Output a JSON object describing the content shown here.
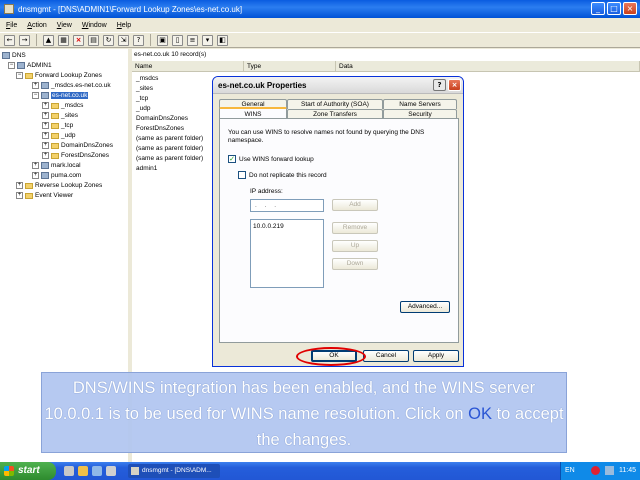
{
  "window": {
    "title": "dnsmgmt - [DNS\\ADMIN1\\Forward Lookup Zones\\es-net.co.uk]",
    "menu": [
      "File",
      "Action",
      "View",
      "Window",
      "Help"
    ]
  },
  "tree": [
    {
      "label": "DNS",
      "indent": 0,
      "type": "dns"
    },
    {
      "label": "ADMIN1",
      "indent": 1,
      "type": "server"
    },
    {
      "label": "Forward Lookup Zones",
      "indent": 2,
      "type": "folder"
    },
    {
      "label": "_msdcs.es-net.co.uk",
      "indent": 3,
      "type": "zone"
    },
    {
      "label": "es-net.co.uk",
      "indent": 3,
      "type": "zone",
      "selected": true
    },
    {
      "label": "_msdcs",
      "indent": 4,
      "type": "folder"
    },
    {
      "label": "_sites",
      "indent": 4,
      "type": "folder"
    },
    {
      "label": "_tcp",
      "indent": 4,
      "type": "folder"
    },
    {
      "label": "_udp",
      "indent": 4,
      "type": "folder"
    },
    {
      "label": "DomainDnsZones",
      "indent": 4,
      "type": "folder"
    },
    {
      "label": "ForestDnsZones",
      "indent": 4,
      "type": "folder"
    },
    {
      "label": "mark.local",
      "indent": 3,
      "type": "zone"
    },
    {
      "label": "puma.com",
      "indent": 3,
      "type": "zone"
    },
    {
      "label": "Reverse Lookup Zones",
      "indent": 2,
      "type": "folder"
    },
    {
      "label": "Event Viewer",
      "indent": 2,
      "type": "folder"
    }
  ],
  "list": {
    "header": "es-net.co.uk    10 record(s)",
    "columns": [
      "Name",
      "Type",
      "Data"
    ],
    "rows": [
      "_msdcs",
      "_sites",
      "_tcp",
      "_udp",
      "DomainDnsZones",
      "ForestDnsZones",
      "(same as parent folder)",
      "(same as parent folder)",
      "(same as parent folder)",
      "admin1"
    ]
  },
  "dialog": {
    "title": "es-net.co.uk Properties",
    "tabs_back": [
      "General",
      "Start of Authority (SOA)",
      "Name Servers"
    ],
    "tabs_front": [
      "WINS",
      "Zone Transfers",
      "Security"
    ],
    "description": "You can use WINS to resolve names not found by querying the DNS namespace.",
    "use_wins_label": "Use WINS forward lookup",
    "no_replicate_label": "Do not replicate this record",
    "ip_label": "IP address:",
    "ip_placeholder": ". . .",
    "wins_servers": [
      "10.0.0.219"
    ],
    "buttons": {
      "add": "Add",
      "remove": "Remove",
      "up": "Up",
      "down": "Down",
      "advanced": "Advanced...",
      "ok": "OK",
      "cancel": "Cancel",
      "apply": "Apply"
    }
  },
  "caption": {
    "text_before": "DNS/WINS integration has been enabled, and the WINS server 10.0.0.1 is to be used for WINS name resolution. Click on ",
    "highlight": "OK",
    "text_after": " to accept the changes."
  },
  "taskbar": {
    "start": "start",
    "task": "dnsmgmt - [DNS\\ADM...",
    "lang": "EN",
    "clock": "11:45"
  },
  "colors": {
    "accent": "#2a55d4",
    "caption_bg": "#b0c4f0",
    "highlight_ring": "#e00000"
  }
}
